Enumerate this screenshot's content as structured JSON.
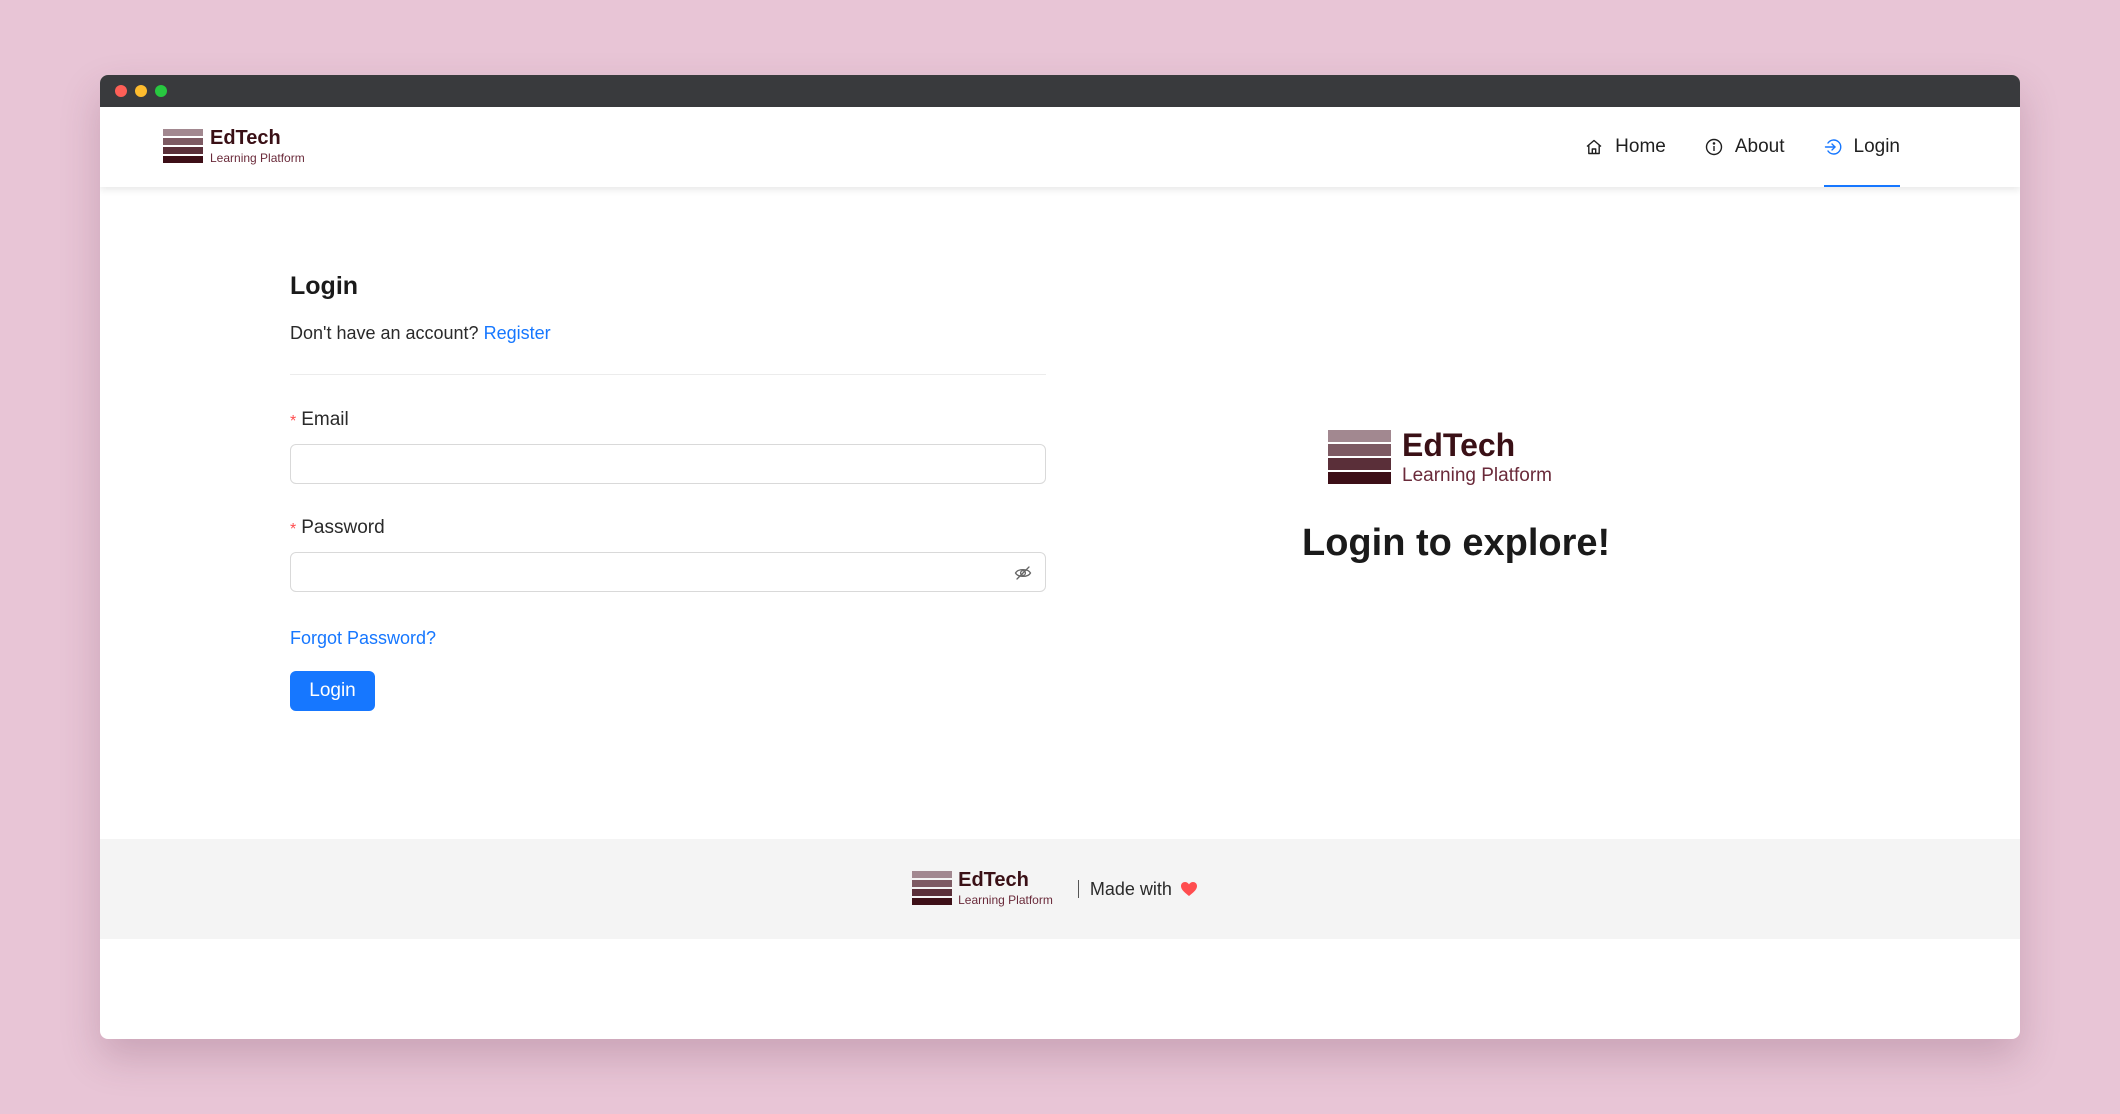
{
  "brand": {
    "name": "EdTech",
    "tagline": "Learning Platform",
    "stack_colors": [
      "#a28890",
      "#7d5a63",
      "#5a2f39",
      "#3d0f17"
    ]
  },
  "nav": {
    "items": [
      {
        "label": "Home",
        "icon": "home-icon"
      },
      {
        "label": "About",
        "icon": "info-icon"
      },
      {
        "label": "Login",
        "icon": "login-icon",
        "active": true
      }
    ],
    "active_color": "#1677ff"
  },
  "login_form": {
    "title": "Login",
    "no_account_text": "Don't have an account?",
    "register_link": "Register",
    "required_mark": "*",
    "email": {
      "label": "Email",
      "value": "",
      "placeholder": ""
    },
    "password": {
      "label": "Password",
      "value": "",
      "placeholder": "",
      "toggle_icon": "eye-invisible-icon"
    },
    "forgot_link": "Forgot Password?",
    "submit_label": "Login",
    "primary_color": "#1677ff"
  },
  "promo": {
    "heading": "Login to explore!"
  },
  "footer": {
    "made_with": "Made with",
    "heart_icon": "heart-icon",
    "heart_color": "#ff4d4f"
  },
  "window_controls": {
    "colors": [
      "#fe5f57",
      "#febc2e",
      "#28c840"
    ]
  }
}
